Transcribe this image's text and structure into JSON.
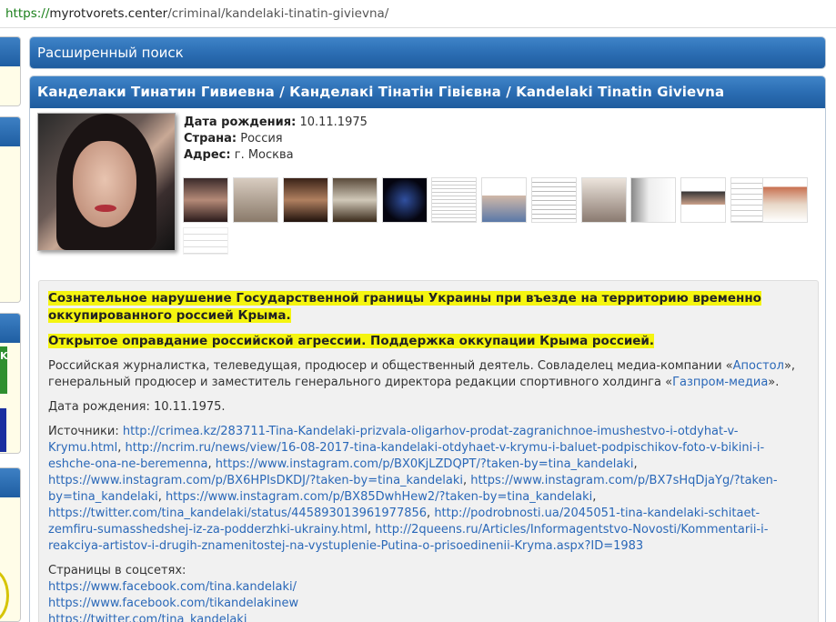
{
  "browser": {
    "url_scheme": "https://",
    "url_host": "myrotvorets.center",
    "url_path": "/criminal/kandelaki-tinatin-givievna/"
  },
  "search_panel": {
    "title": "Расширенный поиск"
  },
  "profile": {
    "title": "Канделаки Тинатин Гивиевна / Канделакі Тінатін Гівієвна / Kandelaki Tinatin Givievna",
    "birth_label": "Дата рождения:",
    "birth_value": "10.11.1975",
    "country_label": "Страна:",
    "country_value": "Россия",
    "address_label": "Адрес:",
    "address_value": "г. Москва"
  },
  "content": {
    "highlight1": "Сознательное нарушение Государственной границы Украины при въезде на территорию временно оккупированного россией Крыма.",
    "highlight2": "Открытое оправдание российской агрессии. Поддержка оккупации Крыма россией.",
    "bio_part1": "Российская журналистка, телеведущая, продюсер и общественный деятель. Совладелец медиа-компании «",
    "bio_link1": "Апостол",
    "bio_part2": "», генеральный продюсер и заместитель генерального директора редакции спортивного холдинга «",
    "bio_link2": "Газпром-медиа",
    "bio_part3": "».",
    "birth_line": "Дата рождения: 10.11.1975.",
    "sources_label": "Источники:",
    "sources": [
      "http://crimea.kz/283711-Tina-Kandelaki-prizvala-oligarhov-prodat-zagranichnoe-imushestvo-i-otdyhat-v-Krymu.html",
      "http://ncrim.ru/news/view/16-08-2017-tina-kandelaki-otdyhaet-v-krymu-i-baluet-podpischikov-foto-v-bikini-i-eshche-ona-ne-beremenna",
      "https://www.instagram.com/p/BX0KjLZDQPT/?taken-by=tina_kandelaki",
      "https://www.instagram.com/p/BX6HPIsDKDJ/?taken-by=tina_kandelaki",
      "https://www.instagram.com/p/BX7sHqDjaYg/?taken-by=tina_kandelaki",
      "https://www.instagram.com/p/BX85DwhHew2/?taken-by=tina_kandelaki",
      "https://twitter.com/tina_kandelaki/status/445893013961977856",
      "http://podrobnosti.ua/2045051-tina-kandelaki-schitaet-zemfiru-sumasshedshej-iz-za-podderzhki-ukrainy.html",
      "http://2queens.ru/Articles/Informagentstvo-Novosti/Kommentarii-i-reakciya-artistov-i-drugih-znamenitostej-na-vystuplenie-Putina-o-prisoedinenii-Kryma.aspx?ID=1983"
    ],
    "social_label": "Страницы в соцсетях:",
    "social": [
      "https://www.facebook.com/tina.kandelaki/",
      "https://www.facebook.com/tikandelakinew",
      "https://twitter.com/tina_kandelaki"
    ]
  },
  "left_strip": {
    "wk_label": "K"
  }
}
